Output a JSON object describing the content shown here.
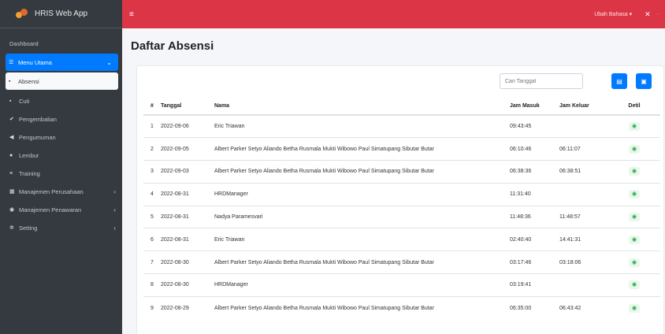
{
  "app": {
    "title": "HRIS Web App"
  },
  "topbar": {
    "hamburger_icon": "menu-icon",
    "language": "Ubah Bahasa",
    "language_caret": "▾",
    "expand_icon": "expand-icon",
    "more_text": "·"
  },
  "sidebar": {
    "items": [
      {
        "label": "Dashboard",
        "icon": "",
        "arrow": ""
      },
      {
        "label": "Menu Utama",
        "icon": "☰",
        "arrow": "⌄"
      },
      {
        "label": "Absensi",
        "icon": "▪",
        "arrow": ""
      },
      {
        "label": "Cuti",
        "icon": "▪",
        "arrow": ""
      },
      {
        "label": "Pengembalian",
        "icon": "✔",
        "arrow": ""
      },
      {
        "label": "Pengumuman",
        "icon": "◀",
        "arrow": ""
      },
      {
        "label": "Lembur",
        "icon": "●",
        "arrow": ""
      },
      {
        "label": "Training",
        "icon": "≡",
        "arrow": ""
      },
      {
        "label": "Manajemen Perusahaan",
        "icon": "▦",
        "arrow": "‹"
      },
      {
        "label": "Manajemen Penawaran",
        "icon": "◉",
        "arrow": "‹"
      },
      {
        "label": "Setting",
        "icon": "✲",
        "arrow": "‹"
      }
    ]
  },
  "page": {
    "title": "Daftar Absensi"
  },
  "toolbar": {
    "search_placeholder": "Cari Tanggal",
    "print_icon": "▤",
    "save_icon": "▣"
  },
  "table": {
    "headers": [
      "#",
      "Tanggal",
      "Nama",
      "Jam Masuk",
      "Jam Keluar",
      "Detil"
    ],
    "rows": [
      [
        "1",
        "2022-09-06",
        "Eric Triawan",
        "09:43:45",
        "",
        "◉"
      ],
      [
        "2",
        "2022-09-05",
        "Albert Parker Setyo Aliando Betha Rusmala Mukti Wibowo Paul Simatupang Sibutar Butar",
        "06:10:46",
        "06:11:07",
        "◉"
      ],
      [
        "3",
        "2022-09-03",
        "Albert Parker Setyo Aliando Betha Rusmala Mukti Wibowo Paul Simatupang Sibutar Butar",
        "06:38:36",
        "06:38:51",
        "◉"
      ],
      [
        "4",
        "2022-08-31",
        "HRDManager",
        "11:31:40",
        "",
        "◉"
      ],
      [
        "5",
        "2022-08-31",
        "Nadya Paramesvari",
        "11:48:36",
        "11:48:57",
        "◉"
      ],
      [
        "6",
        "2022-08-31",
        "Eric Triawan",
        "02:40:40",
        "14:41:31",
        "◉"
      ],
      [
        "7",
        "2022-08-30",
        "Albert Parker Setyo Aliando Betha Rusmala Mukti Wibowo Paul Simatupang Sibutar Butar",
        "03:17:46",
        "03:18:06",
        "◉"
      ],
      [
        "8",
        "2022-08-30",
        "HRDManager",
        "03:19:41",
        "",
        "◉"
      ],
      [
        "9",
        "2022-08-29",
        "Albert Parker Setyo Aliando Betha Rusmala Mukti Wibowo Paul Simatupang Sibutar Butar",
        "06:35:00",
        "06:43:42",
        "◉"
      ]
    ]
  }
}
